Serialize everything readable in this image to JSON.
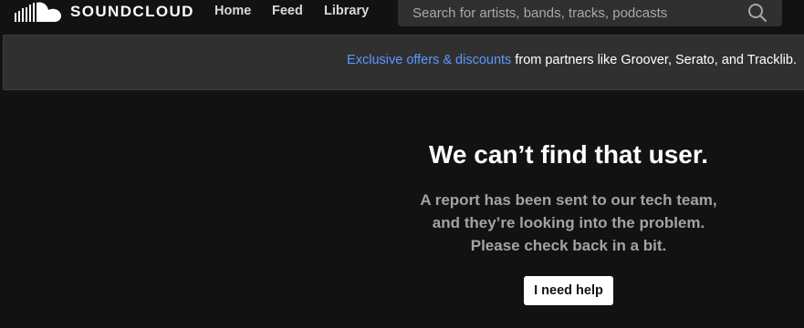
{
  "header": {
    "logo_text": "SOUNDCLOUD",
    "nav": {
      "home": "Home",
      "feed": "Feed",
      "library": "Library"
    },
    "search_placeholder": "Search for artists, bands, tracks, podcasts"
  },
  "banner": {
    "link_text": "Exclusive offers & discounts",
    "rest_text": " from partners like Groover, Serato, and Tracklib."
  },
  "error": {
    "title": "We can’t find that user.",
    "message_line1": "A report has been sent to our tech team,",
    "message_line2": "and they’re looking into the problem.",
    "message_line3": "Please check back in a bit.",
    "help_button": "I need help"
  },
  "colors": {
    "background": "#121212",
    "panel": "#303030",
    "link": "#5c97ff",
    "muted_text": "#a3a3a3"
  },
  "icons": {
    "logo": "soundcloud-cloud-icon",
    "search": "search-icon"
  }
}
